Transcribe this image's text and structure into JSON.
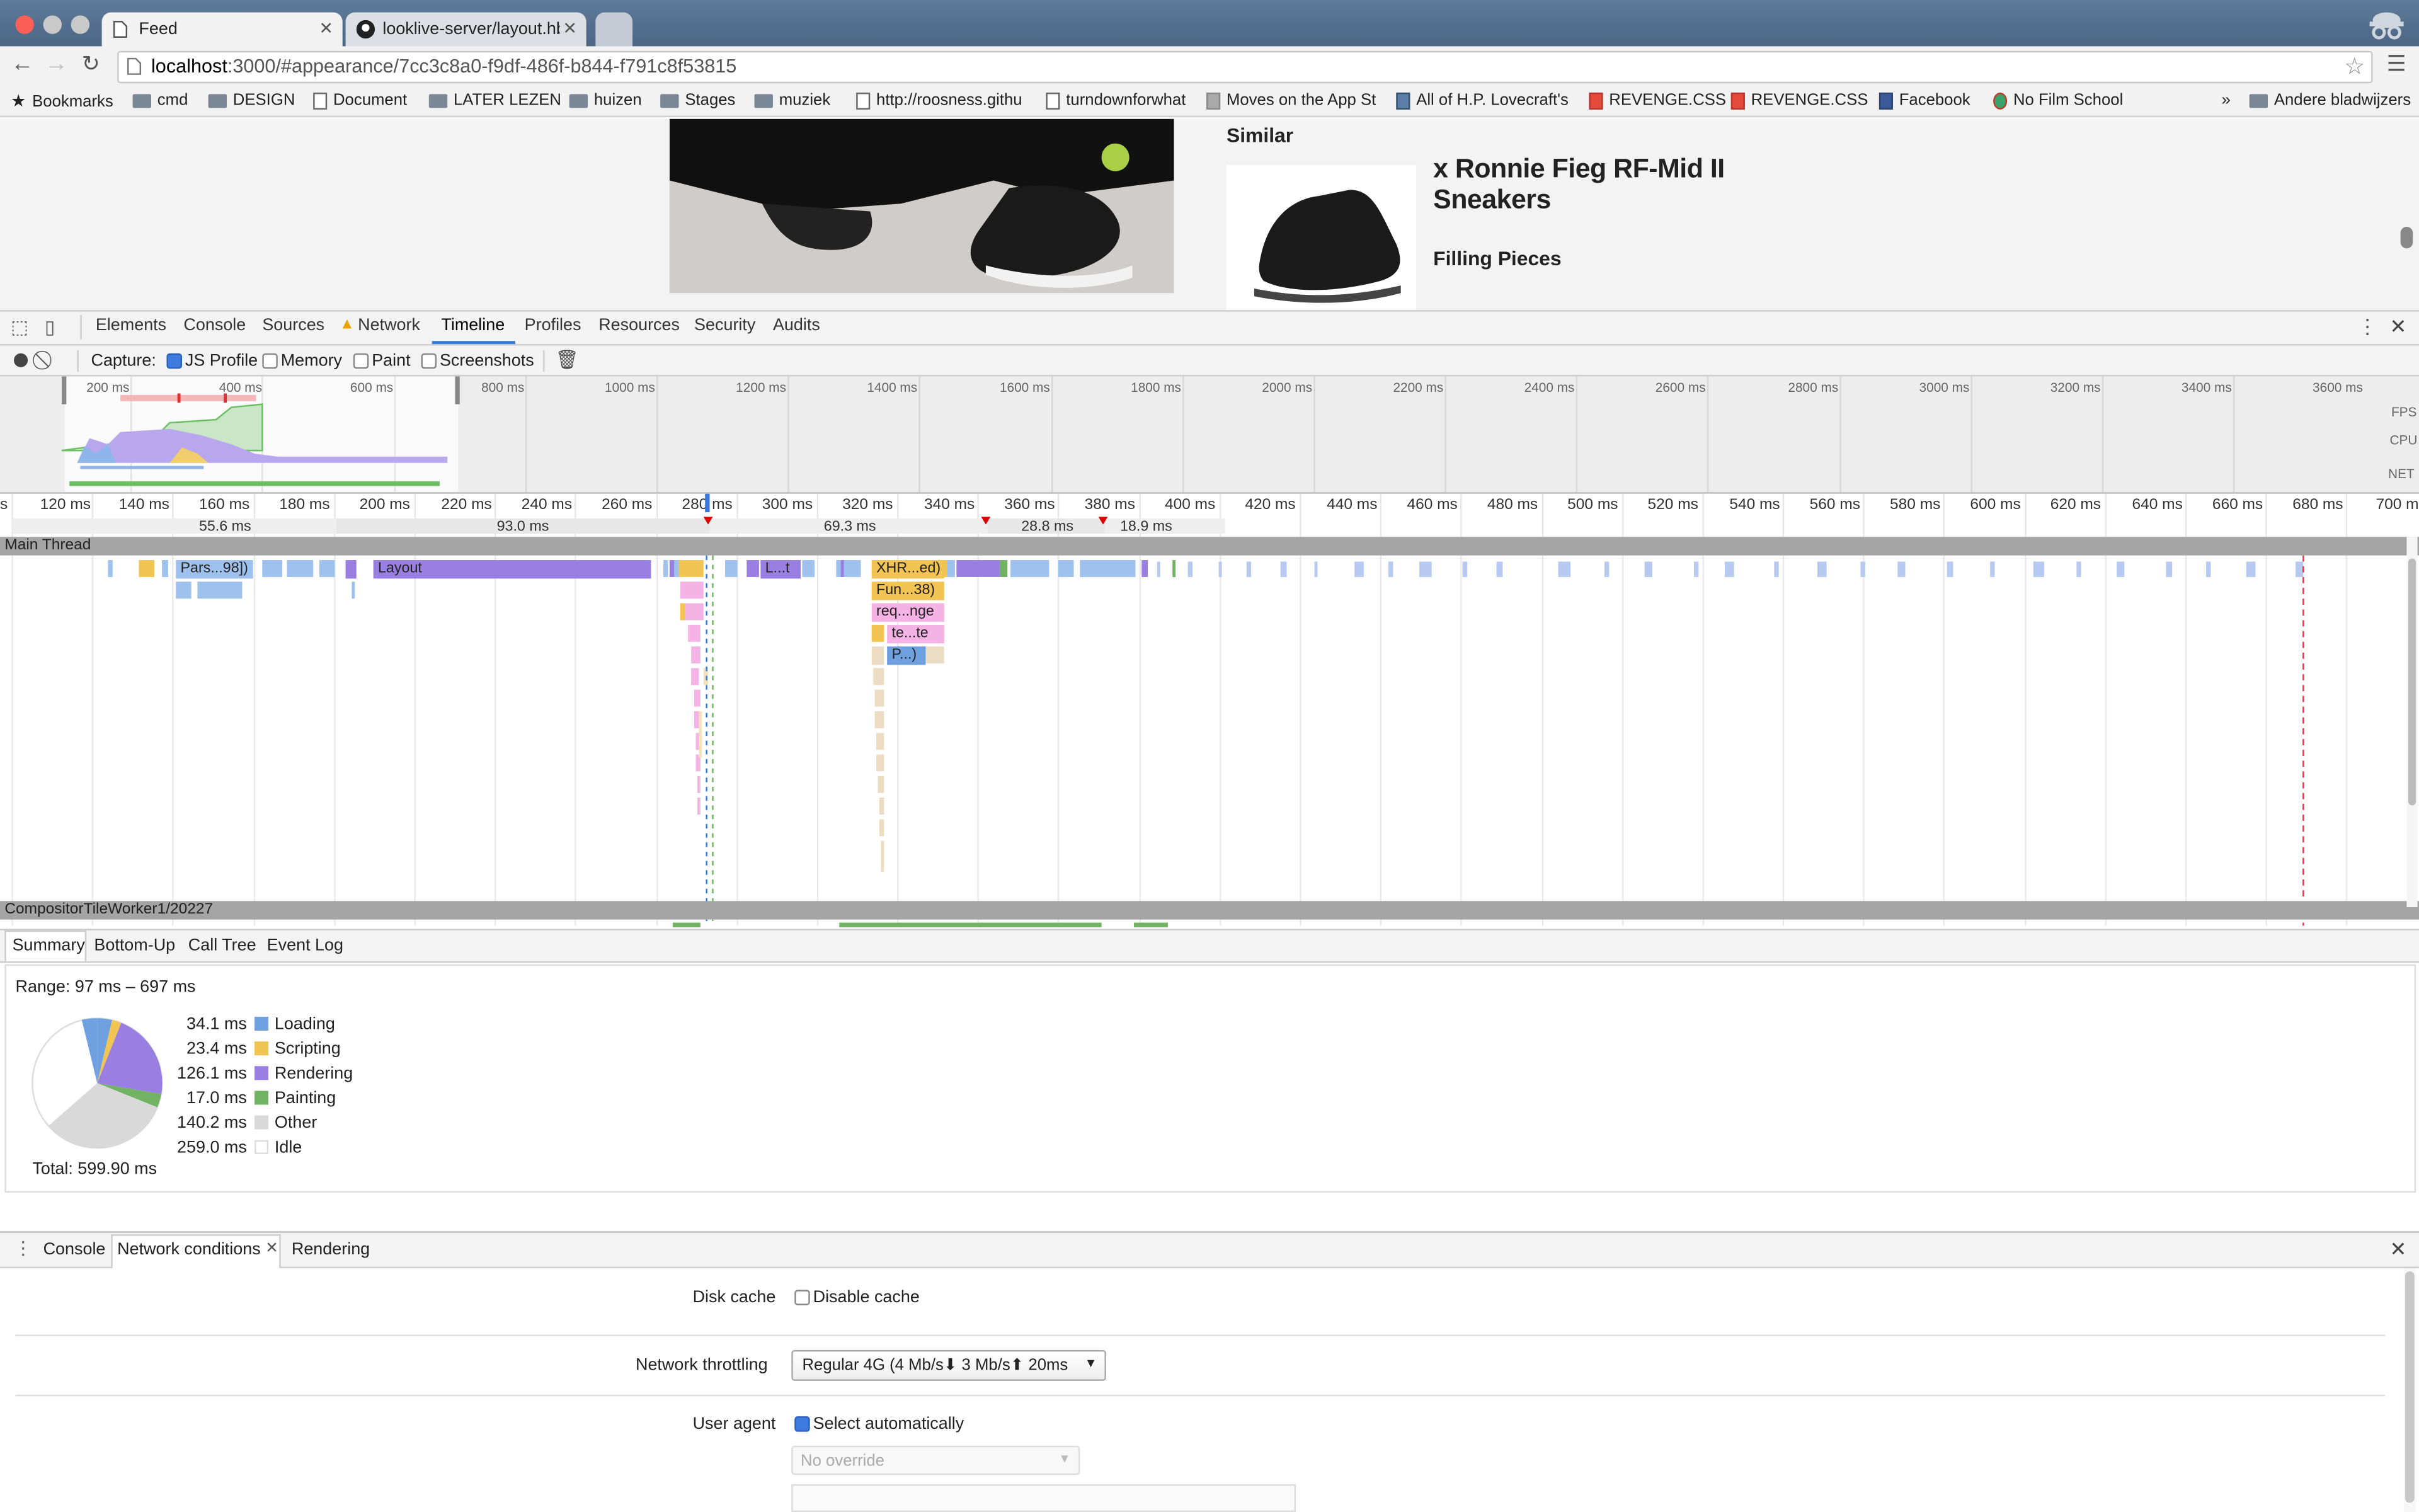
{
  "browser": {
    "tabs": [
      {
        "title": "Feed",
        "active": true
      },
      {
        "title": "looklive-server/layout.hbs a",
        "active": false
      }
    ],
    "url_host": "localhost",
    "url_rest": ":3000/#appearance/7cc3c8a0-f9df-486f-b844-f791c8f53815"
  },
  "bookmarks": [
    "Bookmarks",
    "cmd",
    "DESIGN",
    "Document",
    "LATER LEZEN",
    "huizen",
    "Stages",
    "muziek",
    "http://roosness.githu",
    "turndownforwhat",
    "Moves on the App St",
    "All of H.P. Lovecraft's",
    "REVENGE.CSS",
    "REVENGE.CSS",
    "Facebook",
    "No Film School"
  ],
  "bookmarks_more": "»",
  "bookmarks_other": "Andere bladwijzers",
  "page": {
    "similar_label": "Similar",
    "product_title": "x Ronnie Fieg RF-Mid II Sneakers",
    "brand": "Filling Pieces"
  },
  "devtools": {
    "panels": [
      "Elements",
      "Console",
      "Sources",
      "Network",
      "Timeline",
      "Profiles",
      "Resources",
      "Security",
      "Audits"
    ],
    "active_panel": "Timeline",
    "warning_panel": "Network",
    "capture_label": "Capture:",
    "options": [
      {
        "label": "JS Profile",
        "checked": true
      },
      {
        "label": "Memory",
        "checked": false
      },
      {
        "label": "Paint",
        "checked": false
      },
      {
        "label": "Screenshots",
        "checked": false
      }
    ],
    "overview_ticks": [
      "200 ms",
      "400 ms",
      "600 ms",
      "800 ms",
      "1000 ms",
      "1200 ms",
      "1400 ms",
      "1600 ms",
      "1800 ms",
      "2000 ms",
      "2200 ms",
      "2400 ms",
      "2600 ms",
      "2800 ms",
      "3000 ms",
      "3200 ms",
      "3400 ms",
      "3600 ms"
    ],
    "overview_lanes": [
      "FPS",
      "CPU",
      "NET"
    ],
    "ruler_ticks": [
      "s",
      "120 ms",
      "140 ms",
      "160 ms",
      "180 ms",
      "200 ms",
      "220 ms",
      "240 ms",
      "260 ms",
      "280 ms",
      "300 ms",
      "320 ms",
      "340 ms",
      "360 ms",
      "380 ms",
      "400 ms",
      "420 ms",
      "440 ms",
      "460 ms",
      "480 ms",
      "500 ms",
      "520 ms",
      "540 ms",
      "560 ms",
      "580 ms",
      "600 ms",
      "620 ms",
      "640 ms",
      "660 ms",
      "680 ms",
      "700 m"
    ],
    "frames": [
      "55.6 ms",
      "93.0 ms",
      "69.3 ms",
      "28.8 ms",
      "18.9 ms"
    ],
    "main_thread": "Main Thread",
    "flame": [
      "Pars...98])",
      "Layout",
      "L...t",
      "XHR...ed)",
      "Fun...38)",
      "req...nge",
      "te...te",
      "P...)"
    ],
    "compositor": "CompositorTileWorker1/20227",
    "bottom_tabs": [
      "Summary",
      "Bottom-Up",
      "Call Tree",
      "Event Log"
    ],
    "range": "Range: 97 ms – 697 ms",
    "summary": [
      {
        "value": "34.1 ms",
        "label": "Loading",
        "color": "#6fa0e0"
      },
      {
        "value": "23.4 ms",
        "label": "Scripting",
        "color": "#f1c453"
      },
      {
        "value": "126.1 ms",
        "label": "Rendering",
        "color": "#9a7fe3"
      },
      {
        "value": "17.0 ms",
        "label": "Painting",
        "color": "#71b363"
      },
      {
        "value": "140.2 ms",
        "label": "Other",
        "color": "#d9d9d9"
      },
      {
        "value": "259.0 ms",
        "label": "Idle",
        "color": "#ffffff"
      }
    ],
    "total": "Total: 599.90 ms",
    "drawer_tabs": [
      "Console",
      "Network conditions",
      "Rendering"
    ],
    "disk_cache_label": "Disk cache",
    "disable_cache": "Disable cache",
    "throttling_label": "Network throttling",
    "throttling_value": "Regular 4G (4 Mb/s⬇ 3 Mb/s⬆ 20ms",
    "ua_label": "User agent",
    "select_auto": "Select automatically",
    "ua_override": "No override"
  }
}
